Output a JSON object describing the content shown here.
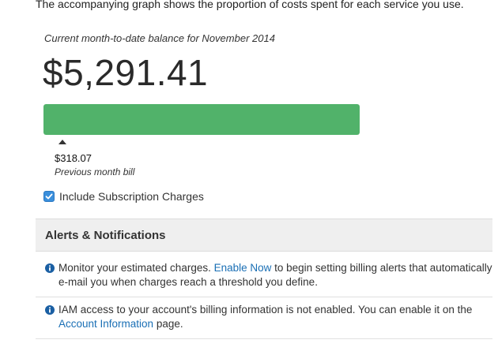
{
  "intro": {
    "text": "The accompanying graph shows the proportion of costs spent for each service you use."
  },
  "balance": {
    "period_label": "Current month-to-date balance for November 2014",
    "amount": "$5,291.41"
  },
  "usage_bar": {
    "fill_fraction": 1.0,
    "fill_color": "#51b26a",
    "previous_marker_fraction": 0.06
  },
  "previous_bill": {
    "amount": "$318.07",
    "label": "Previous month bill"
  },
  "subscription": {
    "checked": true,
    "label": "Include Subscription Charges"
  },
  "alerts": {
    "title": "Alerts & Notifications",
    "notice1": {
      "icon": "info-icon",
      "text_before": "Monitor your estimated charges. ",
      "link": "Enable Now",
      "text_after": " to begin setting billing alerts that automatically e-mail you when charges reach a threshold you define."
    },
    "notice2": {
      "icon": "info-icon",
      "text_before": "IAM access to your account's billing information is not enabled. You can enable it on the ",
      "link": "Account Information",
      "text_after": " page."
    }
  },
  "colors": {
    "accent_link": "#1a6fb5",
    "bar_green": "#51b26a",
    "checkbox_blue": "#3a8fdc"
  }
}
